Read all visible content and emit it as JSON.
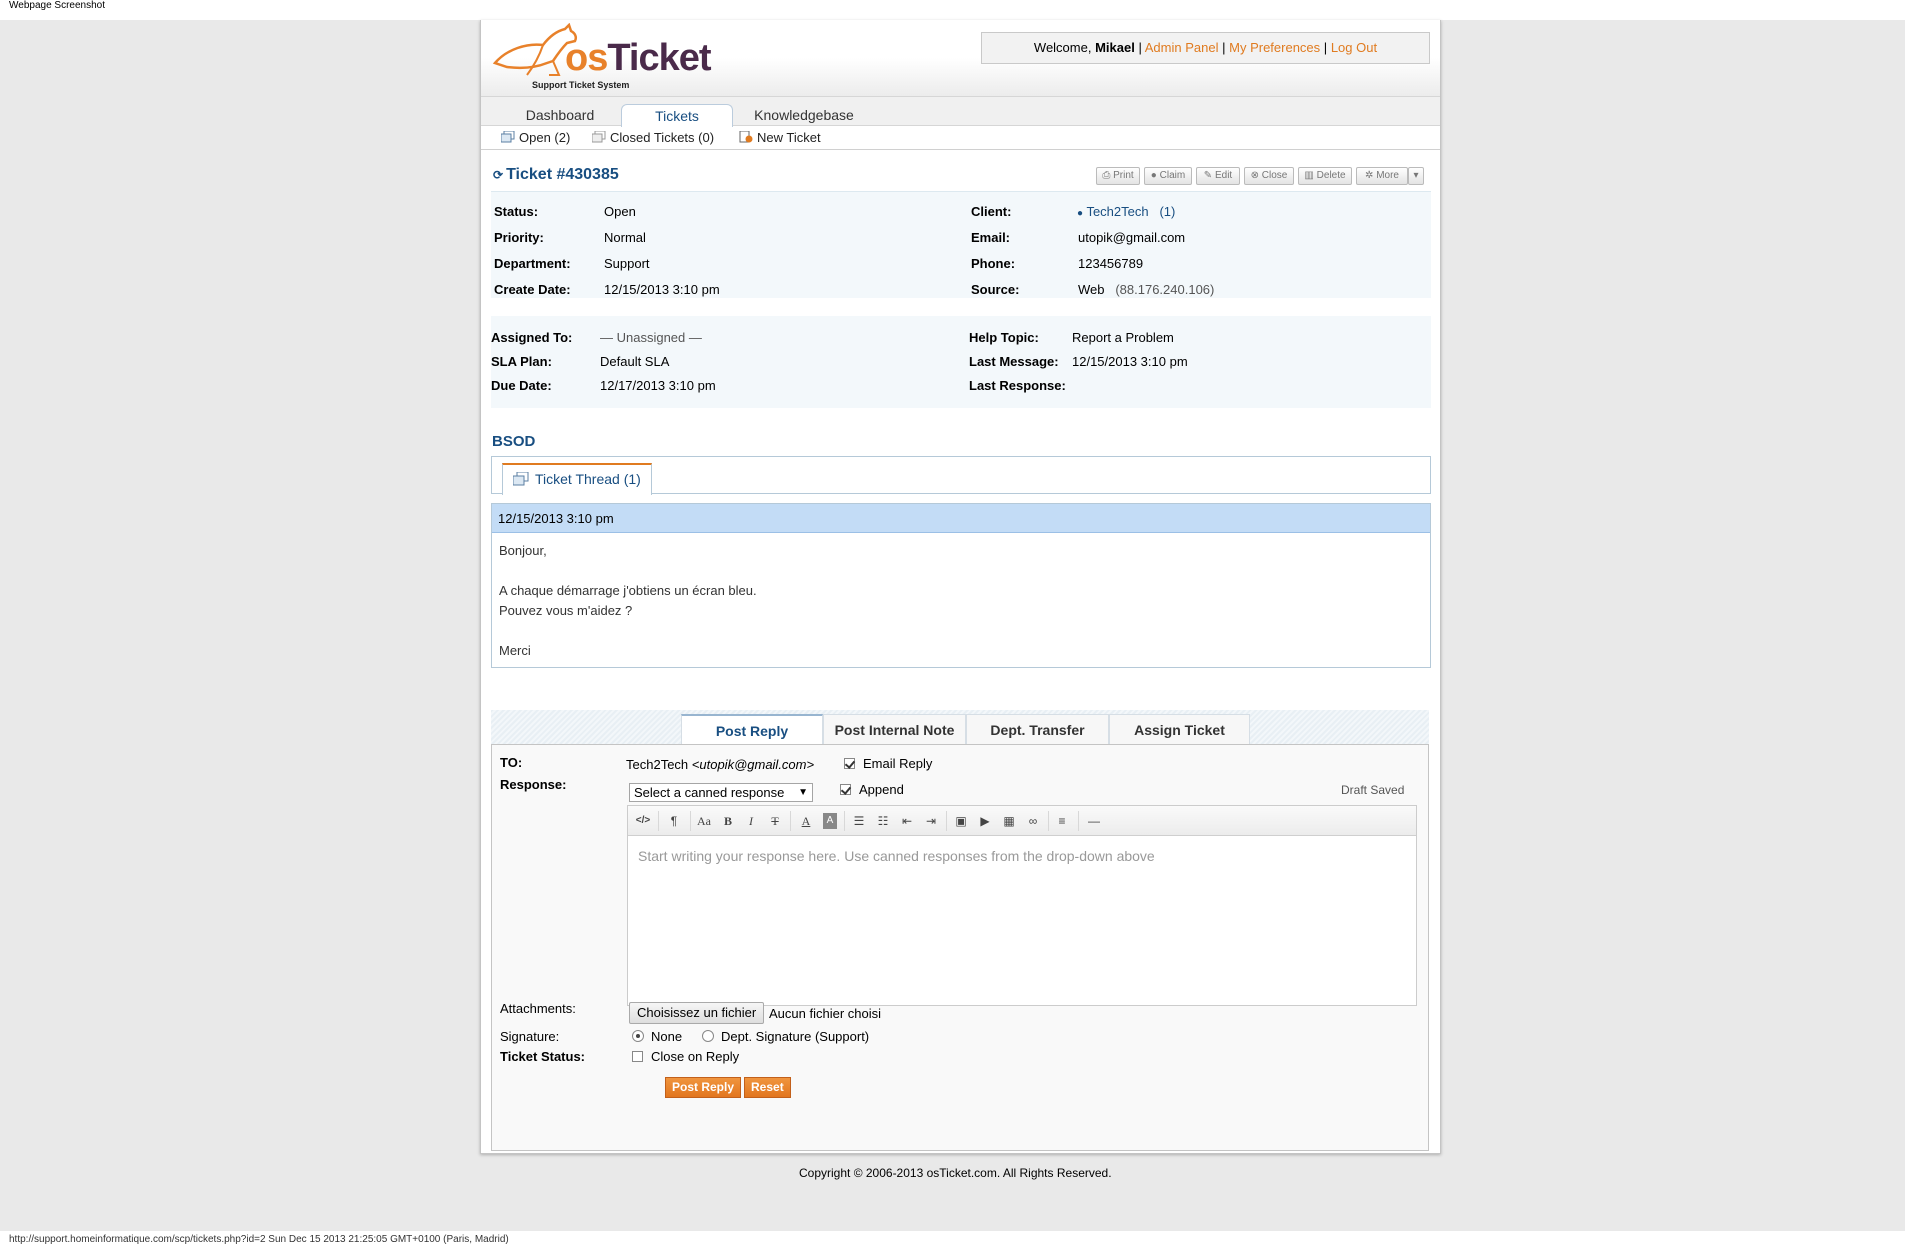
{
  "screenshot_caption": "Webpage Screenshot",
  "status_bar": "http://support.homeinformatique.com/scp/tickets.php?id=2 Sun Dec 15 2013 21:25:05 GMT+0100 (Paris, Madrid)",
  "brand": {
    "logo_text_os": "os",
    "logo_text_ticket": "Ticket",
    "tagline": "Support Ticket System",
    "accent": "#e07b20",
    "primary": "#184e81"
  },
  "userinfo": {
    "welcome": "Welcome,",
    "user": "Mikael",
    "admin_panel": "Admin Panel",
    "preferences": "My Preferences",
    "logout": "Log Out",
    "sep": "|"
  },
  "nav": {
    "tabs": [
      "Dashboard",
      "Tickets",
      "Knowledgebase"
    ],
    "active": "Tickets"
  },
  "subnav": {
    "open": "Open (2)",
    "closed": "Closed Tickets (0)",
    "new": "New Ticket"
  },
  "ticket": {
    "number": "Ticket #430385",
    "actions": [
      "Print",
      "Claim",
      "Edit",
      "Close",
      "Delete",
      "More"
    ],
    "left": [
      {
        "label": "Status:",
        "value": "Open"
      },
      {
        "label": "Priority:",
        "value": "Normal"
      },
      {
        "label": "Department:",
        "value": "Support"
      },
      {
        "label": "Create Date:",
        "value": "12/15/2013 3:10 pm"
      }
    ],
    "right": [
      {
        "label": "Client:",
        "value": "Tech2Tech",
        "extra": "(1)"
      },
      {
        "label": "Email:",
        "value": "utopik@gmail.com"
      },
      {
        "label": "Phone:",
        "value": "123456789"
      },
      {
        "label": "Source:",
        "value": "Web",
        "extra": "(88.176.240.106)"
      }
    ],
    "left2": [
      {
        "label": "Assigned To:",
        "value": "— Unassigned —"
      },
      {
        "label": "SLA Plan:",
        "value": "Default SLA"
      },
      {
        "label": "Due Date:",
        "value": "12/17/2013 3:10 pm"
      }
    ],
    "right2": [
      {
        "label": "Help Topic:",
        "value": "Report a Problem"
      },
      {
        "label": "Last Message:",
        "value": "12/15/2013 3:10 pm"
      },
      {
        "label": "Last Response:",
        "value": ""
      }
    ],
    "subject": "BSOD",
    "thread_tab": "Ticket Thread (1)"
  },
  "message": {
    "date": "12/15/2013 3:10 pm",
    "lines": [
      "Bonjour,",
      "",
      "A chaque démarrage j'obtiens un écran bleu.",
      "Pouvez vous m'aidez ?",
      "",
      "Merci"
    ]
  },
  "response": {
    "tabs": [
      "Post Reply",
      "Post Internal Note",
      "Dept. Transfer",
      "Assign Ticket"
    ],
    "active": "Post Reply",
    "to_label": "TO:",
    "to_name": "Tech2Tech",
    "to_email": "<utopik@gmail.com>",
    "email_reply": "Email Reply",
    "response_label": "Response:",
    "canned_placeholder": "Select a canned response",
    "append": "Append",
    "draft_saved": "Draft Saved",
    "editor_placeholder": "Start writing your response here. Use canned responses from the drop-down above",
    "attachments_label": "Attachments:",
    "file_button": "Choisissez un fichier",
    "file_none": "Aucun fichier choisi",
    "signature_label": "Signature:",
    "sig_none": "None",
    "sig_dept": "Dept. Signature (Support)",
    "status_label": "Ticket Status:",
    "close_on_reply": "Close on Reply",
    "post_button": "Post Reply",
    "reset_button": "Reset"
  },
  "footer": {
    "copyright": "Copyright © 2006-2013 osTicket.com.  All Rights Reserved."
  }
}
